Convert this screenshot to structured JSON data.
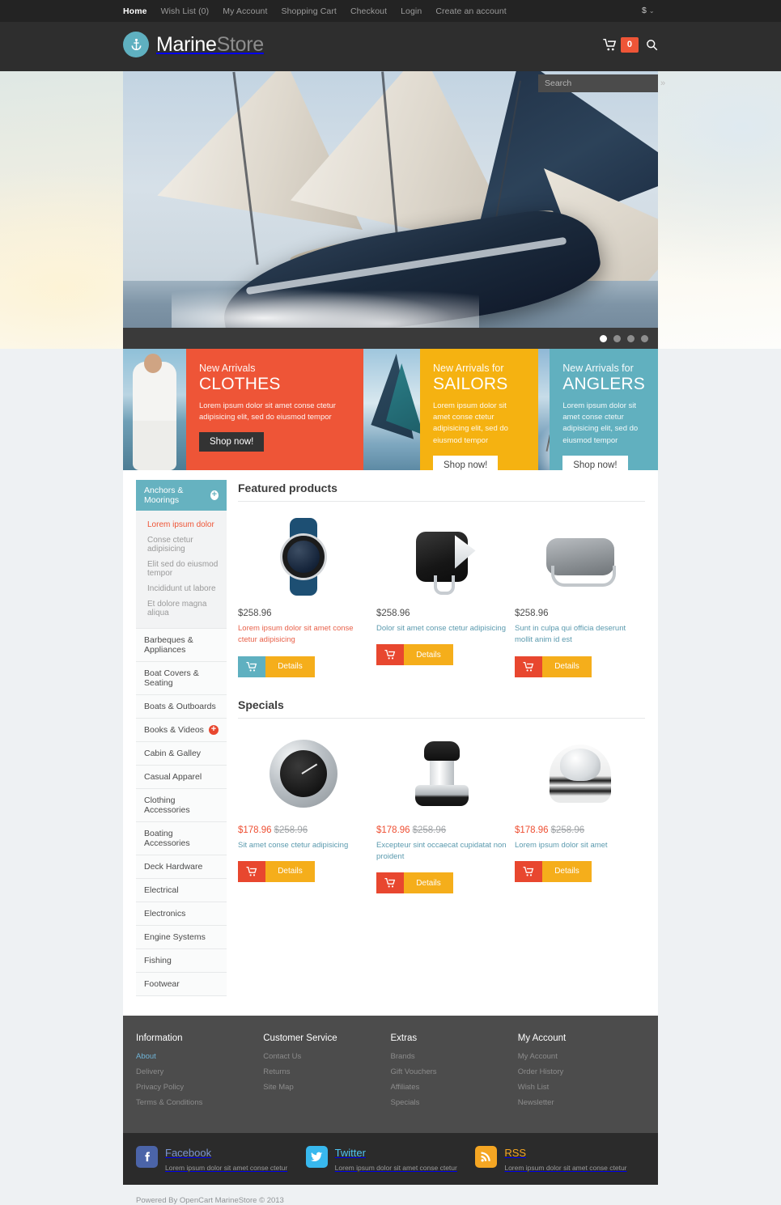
{
  "topbar": {
    "links": [
      {
        "label": "Home",
        "active": true
      },
      {
        "label": "Wish List (0)",
        "active": false
      },
      {
        "label": "My Account",
        "active": false
      },
      {
        "label": "Shopping Cart",
        "active": false
      },
      {
        "label": "Checkout",
        "active": false
      },
      {
        "label": "Login",
        "active": false
      },
      {
        "label": "Create an account",
        "active": false
      }
    ],
    "currency": "$",
    "currency_chevron": "⌄"
  },
  "header": {
    "logo_primary": "Marine",
    "logo_secondary": "Store",
    "cart_count": "0",
    "search_placeholder": "Search",
    "search_value": "",
    "search_submit": "»"
  },
  "slider": {
    "dots": 4,
    "active_dot": 0
  },
  "promos": [
    {
      "kicker": "New Arrivals",
      "title": "CLOTHES",
      "desc": "Lorem ipsum dolor sit amet conse ctetur adipisicing elit, sed do eiusmod tempor",
      "button": "Shop now!",
      "color": "#ee5537"
    },
    {
      "kicker": "New Arrivals for",
      "title": "SAILORS",
      "desc": "Lorem ipsum dolor sit amet conse ctetur adipisicing elit, sed do eiusmod tempor",
      "button": "Shop now!",
      "color": "#f5b211"
    },
    {
      "kicker": "New Arrivals for",
      "title": "ANGLERS",
      "desc": "Lorem ipsum dolor sit amet conse ctetur adipisicing elit, sed do eiusmod tempor",
      "button": "Shop now!",
      "color": "#61b0bf"
    }
  ],
  "sidebar": {
    "active_category": "Anchors & Moorings",
    "active_expander": "+",
    "subitems": [
      {
        "label": "Lorem ipsum dolor",
        "active": true
      },
      {
        "label": "Conse ctetur adipisicing",
        "active": false
      },
      {
        "label": "Elit sed do eiusmod tempor",
        "active": false
      },
      {
        "label": "Incididunt ut labore",
        "active": false
      },
      {
        "label": "Et dolore magna aliqua",
        "active": false
      }
    ],
    "categories": [
      {
        "label": "Barbeques & Appliances",
        "expander": ""
      },
      {
        "label": "Boat Covers & Seating",
        "expander": ""
      },
      {
        "label": "Boats & Outboards",
        "expander": ""
      },
      {
        "label": "Books & Videos",
        "expander": "+"
      },
      {
        "label": "Cabin & Galley",
        "expander": ""
      },
      {
        "label": "Casual Apparel",
        "expander": ""
      },
      {
        "label": "Clothing Accessories",
        "expander": ""
      },
      {
        "label": "Boating Accessories",
        "expander": ""
      },
      {
        "label": "Deck Hardware",
        "expander": ""
      },
      {
        "label": "Electrical",
        "expander": ""
      },
      {
        "label": "Electronics",
        "expander": ""
      },
      {
        "label": "Engine Systems",
        "expander": ""
      },
      {
        "label": "Fishing",
        "expander": ""
      },
      {
        "label": "Footwear",
        "expander": ""
      }
    ]
  },
  "featured": {
    "title": "Featured products",
    "products": [
      {
        "price": "$258.96",
        "name": "Lorem ipsum dolor sit amet conse ctetur adipisicing",
        "details_label": "Details",
        "cart_color": "#5fb0c0"
      },
      {
        "price": "$258.96",
        "name": "Dolor sit amet conse ctetur adipisicing",
        "details_label": "Details",
        "cart_color": "#e8472f"
      },
      {
        "price": "$258.96",
        "name": "Sunt in culpa qui officia deserunt mollit anim id est",
        "details_label": "Details",
        "cart_color": "#e8472f"
      }
    ]
  },
  "specials": {
    "title": "Specials",
    "products": [
      {
        "price": "$178.96",
        "old_price": "$258.96",
        "name": "Sit amet conse ctetur adipisicing",
        "details_label": "Details",
        "cart_color": "#e8472f"
      },
      {
        "price": "$178.96",
        "old_price": "$258.96",
        "name": "Excepteur sint occaecat cupidatat non proident",
        "details_label": "Details",
        "cart_color": "#e8472f"
      },
      {
        "price": "$178.96",
        "old_price": "$258.96",
        "name": "Lorem ipsum dolor sit amet",
        "details_label": "Details",
        "cart_color": "#e8472f"
      }
    ]
  },
  "footer": {
    "columns": [
      {
        "heading": "Information",
        "links": [
          {
            "label": "About",
            "active": true
          },
          {
            "label": "Delivery",
            "active": false
          },
          {
            "label": "Privacy Policy",
            "active": false
          },
          {
            "label": "Terms & Conditions",
            "active": false
          }
        ]
      },
      {
        "heading": "Customer Service",
        "links": [
          {
            "label": "Contact Us",
            "active": false
          },
          {
            "label": "Returns",
            "active": false
          },
          {
            "label": "Site Map",
            "active": false
          }
        ]
      },
      {
        "heading": "Extras",
        "links": [
          {
            "label": "Brands",
            "active": false
          },
          {
            "label": "Gift Vouchers",
            "active": false
          },
          {
            "label": "Affiliates",
            "active": false
          },
          {
            "label": "Specials",
            "active": false
          }
        ]
      },
      {
        "heading": "My Account",
        "links": [
          {
            "label": "My Account",
            "active": false
          },
          {
            "label": "Order History",
            "active": false
          },
          {
            "label": "Wish List",
            "active": false
          },
          {
            "label": "Newsletter",
            "active": false
          }
        ]
      }
    ],
    "social": [
      {
        "name": "Facebook",
        "desc": "Lorem ipsum dolor sit amet conse ctetur"
      },
      {
        "name": "Twitter",
        "desc": "Lorem ipsum dolor sit amet conse ctetur"
      },
      {
        "name": "RSS",
        "desc": "Lorem ipsum dolor sit amet conse ctetur"
      }
    ],
    "copyright": "Powered By OpenCart MarineStore © 2013"
  }
}
